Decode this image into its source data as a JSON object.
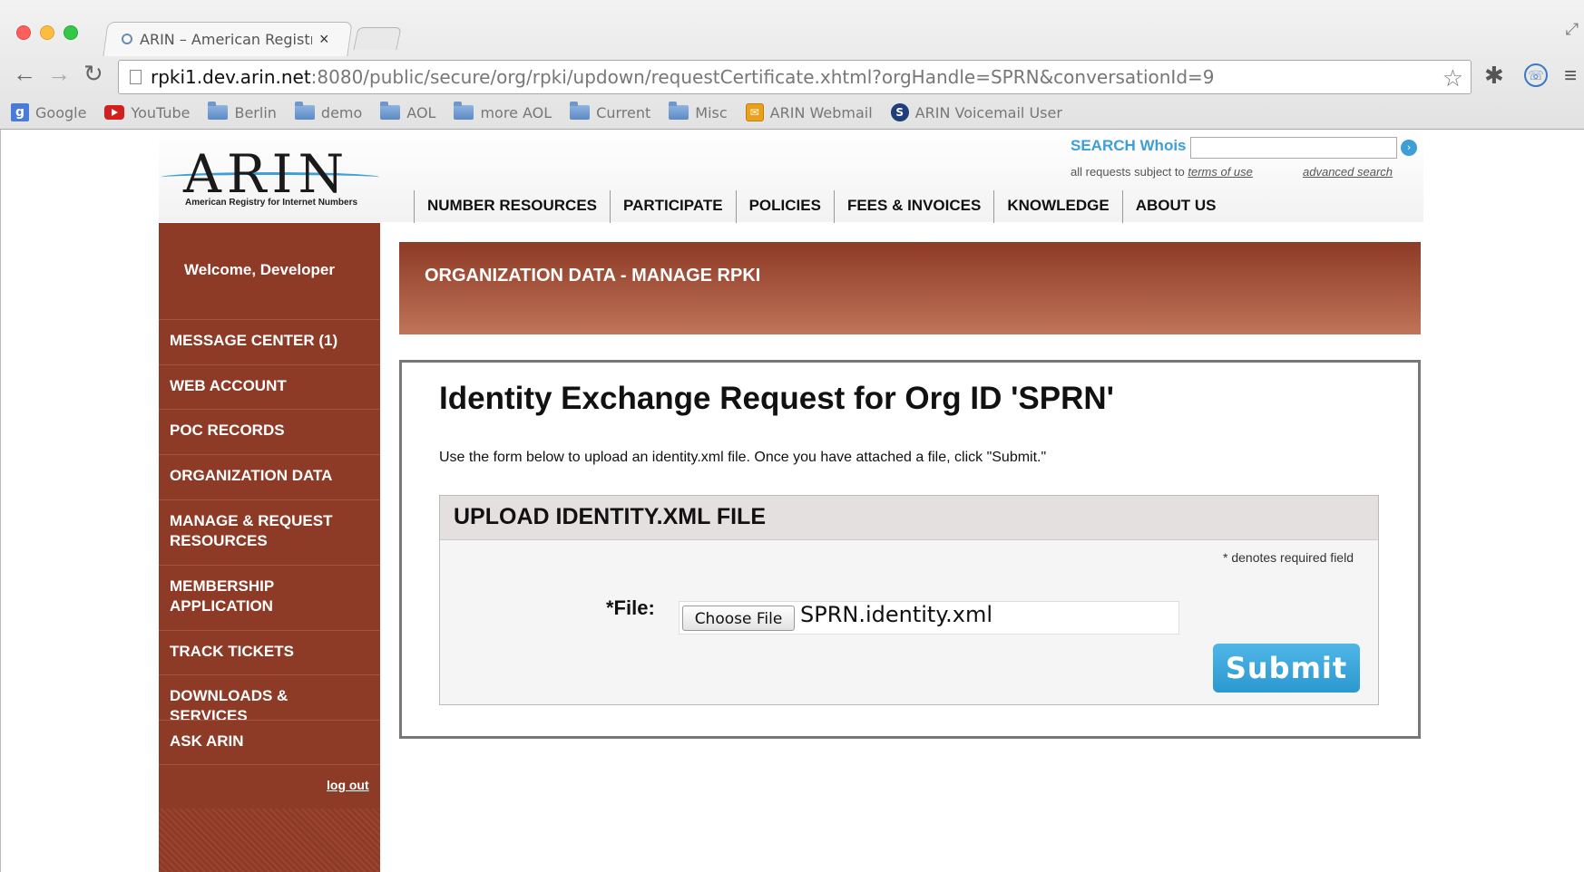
{
  "browser": {
    "tab_title": "ARIN – American Registry",
    "tab_close": "×",
    "url_host": "rpki1.dev.arin.net",
    "url_rest": ":8080/public/secure/org/rpki/updown/requestCertificate.xhtml?orgHandle=SPRN&conversationId=9",
    "bookmarks": [
      {
        "label": "Google",
        "icon": "google-icon"
      },
      {
        "label": "YouTube",
        "icon": "youtube-icon"
      },
      {
        "label": "Berlin",
        "icon": "folder-icon"
      },
      {
        "label": "demo",
        "icon": "folder-icon"
      },
      {
        "label": "AOL",
        "icon": "folder-icon"
      },
      {
        "label": "more AOL",
        "icon": "folder-icon"
      },
      {
        "label": "Current",
        "icon": "folder-icon"
      },
      {
        "label": "Misc",
        "icon": "folder-icon"
      },
      {
        "label": "ARIN Webmail",
        "icon": "mail-icon"
      },
      {
        "label": "ARIN Voicemail User",
        "icon": "voicemail-icon"
      }
    ]
  },
  "header": {
    "logo_text": "ARIN",
    "logo_subtitle": "American Registry for Internet Numbers",
    "search_label": "SEARCH Whois",
    "search_note_prefix": "all requests subject to",
    "search_terms": "terms of use",
    "advanced_search": "advanced search",
    "nav": [
      "NUMBER RESOURCES",
      "PARTICIPATE",
      "POLICIES",
      "FEES & INVOICES",
      "KNOWLEDGE",
      "ABOUT US"
    ]
  },
  "sidebar": {
    "welcome": "Welcome, Developer",
    "items": [
      "MESSAGE CENTER (1)",
      "WEB ACCOUNT",
      "POC RECORDS",
      "ORGANIZATION DATA",
      "MANAGE & REQUEST RESOURCES",
      "MEMBERSHIP APPLICATION",
      "TRACK TICKETS",
      "DOWNLOADS & SERVICES",
      "ASK ARIN"
    ],
    "logout": "log out"
  },
  "main": {
    "banner_title": "ORGANIZATION DATA - MANAGE RPKI",
    "heading": "Identity Exchange Request for Org ID 'SPRN'",
    "instructions": "Use the form below to upload an identity.xml file. Once you have attached a file, click \"Submit.\"",
    "panel_title": "UPLOAD IDENTITY.XML FILE",
    "required_note": "* denotes required field",
    "file_label": "*File:",
    "choose_file": "Choose File",
    "file_name": "SPRN.identity.xml",
    "submit": "Submit"
  }
}
